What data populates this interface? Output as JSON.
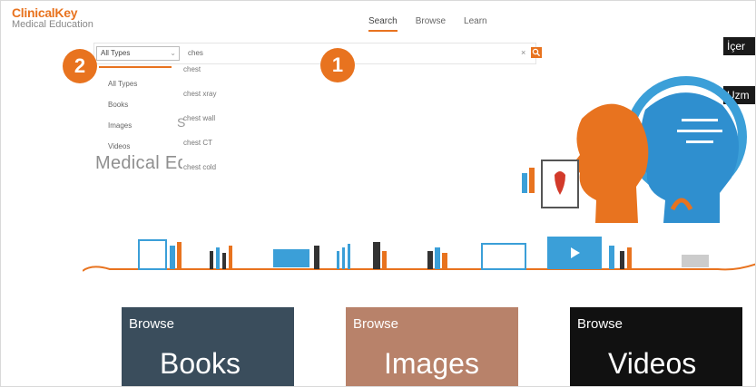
{
  "brand": {
    "name": "ClinicalKey",
    "sub": "Medical Education",
    "accent": "#e8731f"
  },
  "nav": {
    "search": "Search",
    "browse": "Browse",
    "learn": "Learn"
  },
  "search": {
    "type_selected": "All Types",
    "query": "ches",
    "clear": "×",
    "type_options": [
      "All Types",
      "Books",
      "Images",
      "Videos"
    ],
    "suggestions": [
      "chest",
      "chest xray",
      "chest wall",
      "chest CT",
      "chest cold"
    ]
  },
  "hero": {
    "behind_letter": "S",
    "text": "Medical Educ"
  },
  "markers": {
    "one": "1",
    "two": "2"
  },
  "side_labels": {
    "first": "İçer",
    "second": "Uzm"
  },
  "tiles": {
    "books": {
      "small": "Browse",
      "big": "Books"
    },
    "images": {
      "small": "Browse",
      "big": "Images"
    },
    "videos": {
      "small": "Browse",
      "big": "Videos"
    }
  }
}
